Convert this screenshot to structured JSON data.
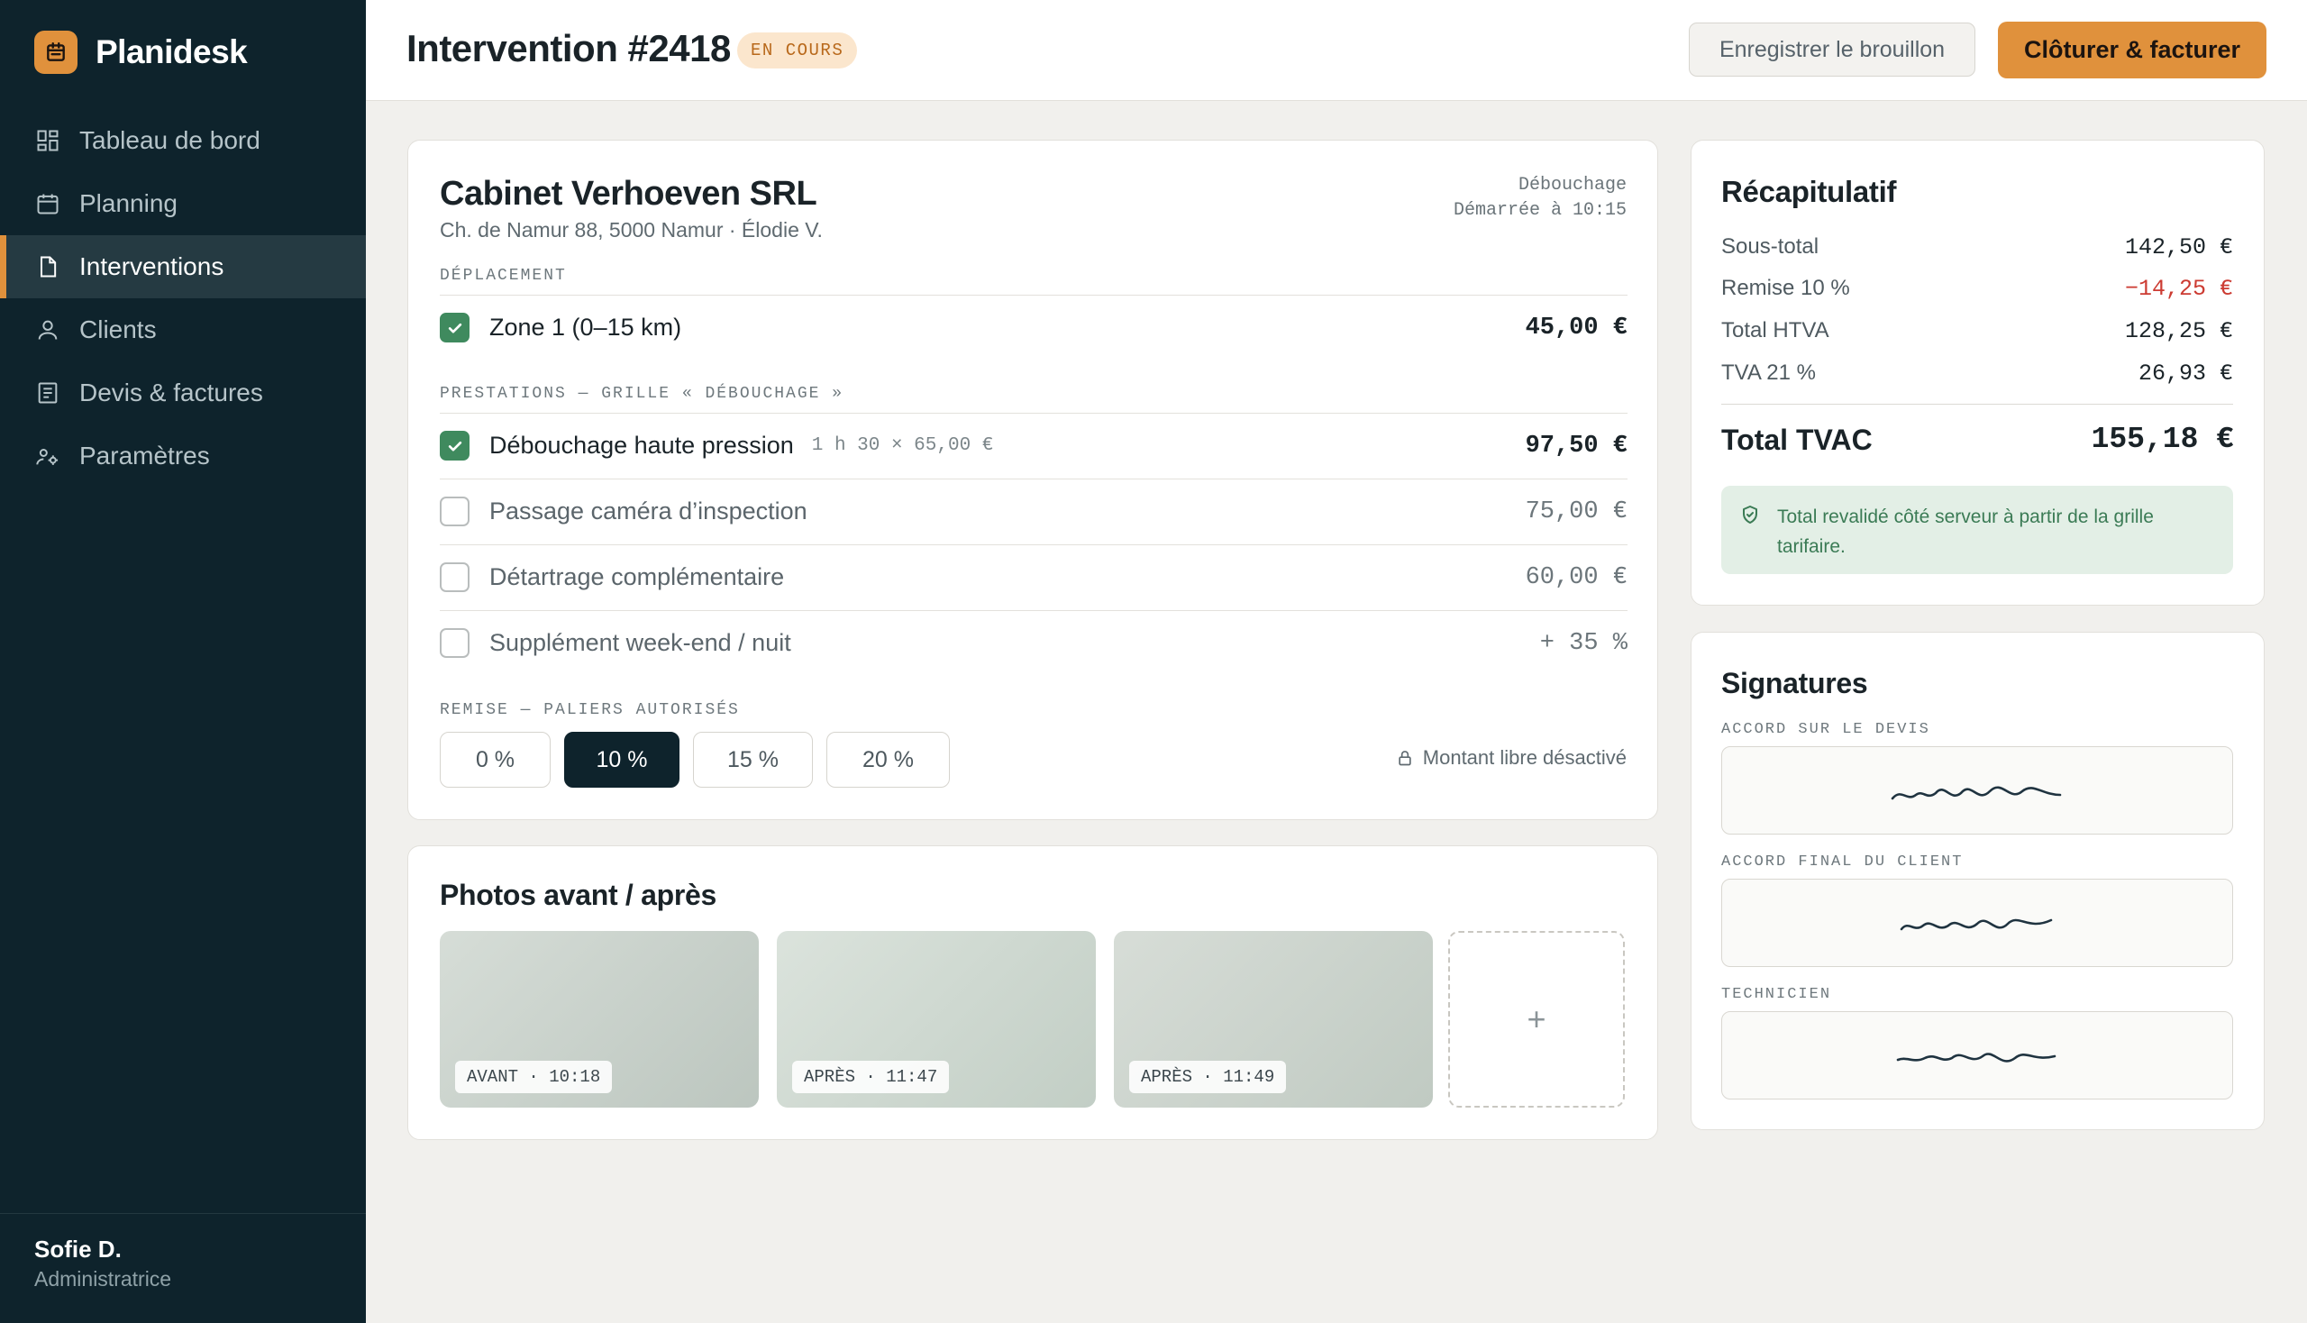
{
  "app": {
    "name": "Planidesk"
  },
  "sidebar": {
    "items": [
      {
        "label": "Tableau de bord",
        "icon": "dashboard-icon"
      },
      {
        "label": "Planning",
        "icon": "calendar-icon"
      },
      {
        "label": "Interventions",
        "icon": "document-icon",
        "active": true
      },
      {
        "label": "Clients",
        "icon": "user-icon"
      },
      {
        "label": "Devis & factures",
        "icon": "invoice-icon"
      },
      {
        "label": "Paramètres",
        "icon": "settings-icon"
      }
    ],
    "user": {
      "name": "Sofie D.",
      "role": "Administratrice"
    }
  },
  "header": {
    "title": "Intervention #2418",
    "status": "EN COURS",
    "draft_button": "Enregistrer le brouillon",
    "close_button": "Clôturer & facturer"
  },
  "intervention": {
    "client": "Cabinet Verhoeven SRL",
    "address": "Ch. de Namur 88, 5000 Namur · Élodie V.",
    "job_type": "Débouchage",
    "started": "Démarrée à 10:15",
    "travel_label": "DÉPLACEMENT",
    "travel": {
      "label": "Zone 1 (0–15 km)",
      "amount": "45,00 €",
      "checked": true
    },
    "services_label": "PRESTATIONS — GRILLE « DÉBOUCHAGE »",
    "services": [
      {
        "label": "Débouchage haute pression",
        "detail": "1 h 30 × 65,00 €",
        "amount": "97,50 €",
        "checked": true
      },
      {
        "label": "Passage caméra d’inspection",
        "detail": "",
        "amount": "75,00 €",
        "checked": false
      },
      {
        "label": "Détartrage complémentaire",
        "detail": "",
        "amount": "60,00 €",
        "checked": false
      },
      {
        "label": "Supplément week-end / nuit",
        "detail": "",
        "amount": "+ 35 %",
        "checked": false
      }
    ],
    "discount_label": "REMISE — PALIERS AUTORISÉS",
    "discount_options": [
      "0 %",
      "10 %",
      "15 %",
      "20 %"
    ],
    "discount_selected": "10 %",
    "free_amount": "Montant libre désactivé"
  },
  "photos": {
    "title": "Photos avant / après",
    "items": [
      "AVANT · 10:18",
      "APRÈS · 11:47",
      "APRÈS · 11:49"
    ],
    "add_label": "+"
  },
  "summary": {
    "title": "Récapitulatif",
    "rows": [
      {
        "label": "Sous-total",
        "value": "142,50 €"
      },
      {
        "label": "Remise 10 %",
        "value": "−14,25 €"
      },
      {
        "label": "Total HTVA",
        "value": "128,25 €"
      },
      {
        "label": "TVA 21 %",
        "value": "26,93 €"
      }
    ],
    "total_label": "Total TVAC",
    "total_value": "155,18 €",
    "notice": "Total revalidé côté serveur à partir de la grille tarifaire."
  },
  "signatures": {
    "title": "Signatures",
    "items": [
      {
        "label": "ACCORD SUR LE DEVIS"
      },
      {
        "label": "ACCORD FINAL DU CLIENT"
      },
      {
        "label": "TECHNICIEN"
      }
    ]
  },
  "colors": {
    "sidebar_bg": "#0e232c",
    "accent": "#e0913c",
    "success": "#3f8a5e",
    "danger": "#cc3b32"
  }
}
